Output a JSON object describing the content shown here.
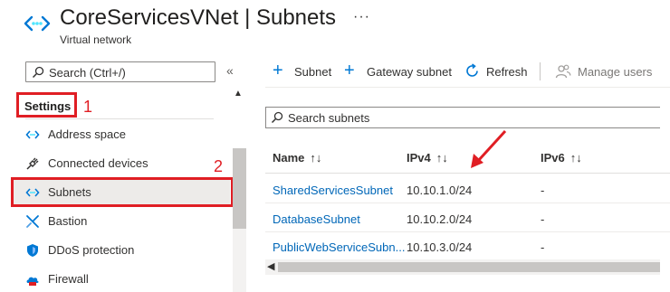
{
  "header": {
    "title": "CoreServicesVNet | Subnets",
    "subtitle": "Virtual network",
    "more": "···"
  },
  "sidebar": {
    "search_placeholder": "Search (Ctrl+/)",
    "collapse_glyph": "«",
    "section_label": "Settings",
    "items": [
      {
        "label": "Address space",
        "icon": "address-space-icon"
      },
      {
        "label": "Connected devices",
        "icon": "plug-icon"
      },
      {
        "label": "Subnets",
        "icon": "subnet-icon",
        "selected": true
      },
      {
        "label": "Bastion",
        "icon": "bastion-icon"
      },
      {
        "label": "DDoS protection",
        "icon": "shield-icon"
      },
      {
        "label": "Firewall",
        "icon": "firewall-icon"
      }
    ]
  },
  "annotations": {
    "marker1": "1",
    "marker2": "2"
  },
  "toolbar": {
    "add_subnet": "Subnet",
    "add_gateway_subnet": "Gateway subnet",
    "refresh": "Refresh",
    "manage_users": "Manage users"
  },
  "subnet_search_placeholder": "Search subnets",
  "table": {
    "columns": [
      "Name",
      "IPv4",
      "IPv6"
    ],
    "sort_glyph": "↑↓",
    "rows": [
      {
        "name": "SharedServicesSubnet",
        "ipv4": "10.10.1.0/24",
        "ipv6": "-"
      },
      {
        "name": "DatabaseSubnet",
        "ipv4": "10.10.2.0/24",
        "ipv6": "-"
      },
      {
        "name": "PublicWebServiceSubn...",
        "ipv4": "10.10.3.0/24",
        "ipv6": "-"
      }
    ]
  },
  "colors": {
    "accent": "#0078d4",
    "annotation_red": "#e01e24",
    "link": "#0067b8"
  }
}
